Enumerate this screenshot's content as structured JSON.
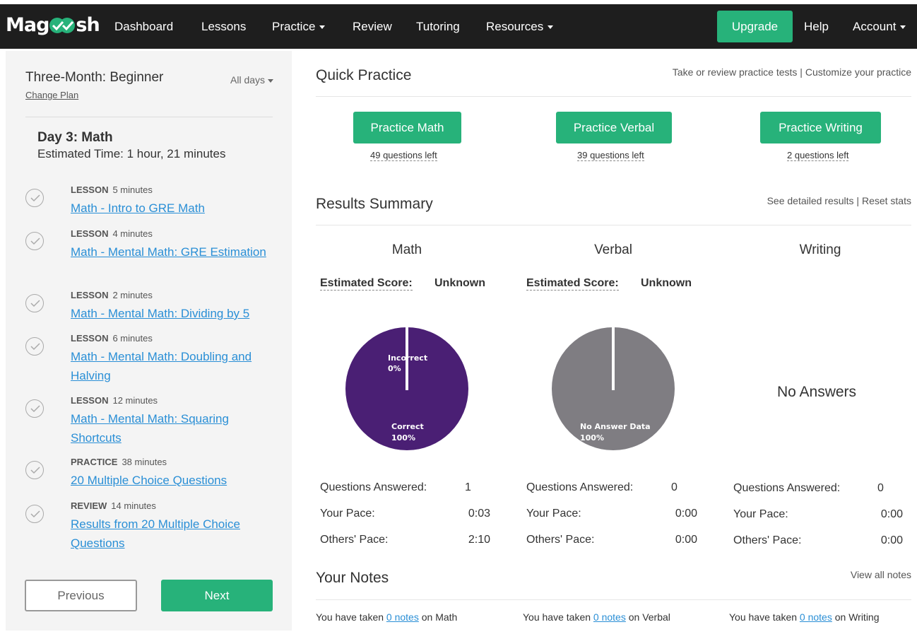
{
  "nav": {
    "logo_left": "Mag",
    "logo_right": "sh",
    "items": [
      "Dashboard",
      "Lessons",
      "Practice",
      "Review",
      "Tutoring",
      "Resources"
    ],
    "upgrade": "Upgrade",
    "help": "Help",
    "account": "Account"
  },
  "sidebar": {
    "plan_title": "Three-Month: Beginner",
    "all_days": "All days",
    "change_plan": "Change Plan",
    "day_title": "Day 3: Math",
    "day_time": "Estimated Time: 1 hour, 21 minutes",
    "tasks": [
      {
        "type": "LESSON",
        "duration": "5 minutes",
        "title": "Math - Intro to GRE Math"
      },
      {
        "type": "LESSON",
        "duration": "4 minutes",
        "title": "Math - Mental Math: GRE Estimation"
      },
      {
        "type": "LESSON",
        "duration": "2 minutes",
        "title": "Math - Mental Math: Dividing by 5"
      },
      {
        "type": "LESSON",
        "duration": "6 minutes",
        "title": "Math - Mental Math: Doubling and Halving"
      },
      {
        "type": "LESSON",
        "duration": "12 minutes",
        "title": "Math - Mental Math: Squaring Shortcuts"
      },
      {
        "type": "PRACTICE",
        "duration": "38 minutes",
        "title": "20 Multiple Choice Questions"
      },
      {
        "type": "REVIEW",
        "duration": "14 minutes",
        "title": "Results from 20 Multiple Choice Questions"
      }
    ],
    "previous": "Previous",
    "next": "Next"
  },
  "quick_practice": {
    "title": "Quick Practice",
    "links": "Take or review practice tests | Customize your practice",
    "math_btn": "Practice Math",
    "math_left": "49 questions left",
    "verbal_btn": "Practice Verbal",
    "verbal_left": "39 questions left",
    "writing_btn": "Practice Writing",
    "writing_left": "2 questions left"
  },
  "results": {
    "title": "Results Summary",
    "links": "See detailed results | Reset stats",
    "est_label": "Estimated Score:",
    "columns": [
      {
        "name": "Math",
        "score": "Unknown",
        "answered": "1",
        "pace": "0:03",
        "others": "2:10"
      },
      {
        "name": "Verbal",
        "score": "Unknown",
        "answered": "0",
        "pace": "0:00",
        "others": "0:00"
      },
      {
        "name": "Writing",
        "no_answers": "No Answers",
        "answered": "0",
        "pace": "0:00",
        "others": "0:00"
      }
    ],
    "labels": {
      "answered": "Questions Answered:",
      "pace": "Your Pace:",
      "others": "Others' Pace:"
    },
    "math_pie": {
      "incorrect_label": "Incorrect",
      "incorrect_pct": "0%",
      "correct_label": "Correct",
      "correct_pct": "100%",
      "correct_value": 100,
      "incorrect_value": 0,
      "color": "#4a1f74"
    },
    "verbal_pie": {
      "label": "No Answer Data",
      "pct": "100%",
      "value": 100,
      "color": "#7f7d82"
    }
  },
  "notes": {
    "title": "Your Notes",
    "view_all": "View all notes",
    "prefix": "You have taken",
    "link": "0 notes",
    "math_suffix": "on Math",
    "verbal_suffix": "on Verbal",
    "writing_suffix": "on Writing"
  },
  "colors": {
    "accent": "#27b27a",
    "topbar": "#1e1e1e",
    "link": "#2a8fd6"
  }
}
